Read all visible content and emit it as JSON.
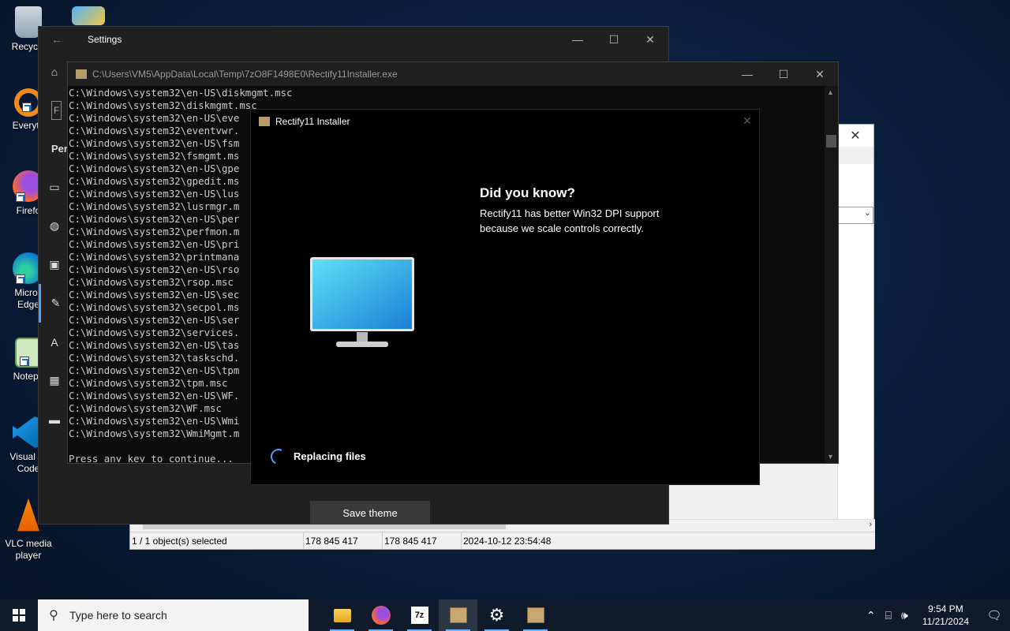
{
  "desktop": {
    "icons": [
      {
        "label": "Recycle",
        "icon": "recycle-bin-icon"
      },
      {
        "label": "Everyth",
        "icon": "everything-search-icon"
      },
      {
        "label": "Firefo",
        "icon": "firefox-icon"
      },
      {
        "label": "Micros\nEdge",
        "icon": "edge-icon"
      },
      {
        "label": "Notepa",
        "icon": "notepad-icon"
      },
      {
        "label": "Visual St\nCode",
        "icon": "vscode-icon"
      },
      {
        "label": "VLC media\nplayer",
        "icon": "vlc-icon"
      }
    ]
  },
  "settings": {
    "title": "Settings",
    "partial_labels": [
      "F",
      "Per"
    ],
    "save_button": "Save theme",
    "nav_icons": [
      "home-icon",
      "picture-icon",
      "palette-icon",
      "lock-screen-icon",
      "themes-icon",
      "font-icon",
      "start-icon",
      "taskbar-icon"
    ]
  },
  "console": {
    "title": "C:\\Users\\VM5\\AppData\\Local\\Temp\\7zO8F1498E0\\Rectify11Installer.exe",
    "lines": [
      "C:\\Windows\\system32\\en-US\\diskmgmt.msc",
      "C:\\Windows\\system32\\diskmgmt.msc",
      "C:\\Windows\\system32\\en-US\\eve",
      "C:\\Windows\\system32\\eventvwr.",
      "C:\\Windows\\system32\\en-US\\fsm",
      "C:\\Windows\\system32\\fsmgmt.ms",
      "C:\\Windows\\system32\\en-US\\gpe",
      "C:\\Windows\\system32\\gpedit.ms",
      "C:\\Windows\\system32\\en-US\\lus",
      "C:\\Windows\\system32\\lusrmgr.m",
      "C:\\Windows\\system32\\en-US\\per",
      "C:\\Windows\\system32\\perfmon.m",
      "C:\\Windows\\system32\\en-US\\pri",
      "C:\\Windows\\system32\\printmana",
      "C:\\Windows\\system32\\en-US\\rso",
      "C:\\Windows\\system32\\rsop.msc",
      "C:\\Windows\\system32\\en-US\\sec",
      "C:\\Windows\\system32\\secpol.ms",
      "C:\\Windows\\system32\\en-US\\ser",
      "C:\\Windows\\system32\\services.",
      "C:\\Windows\\system32\\en-US\\tas",
      "C:\\Windows\\system32\\taskschd.",
      "C:\\Windows\\system32\\en-US\\tpm",
      "C:\\Windows\\system32\\tpm.msc",
      "C:\\Windows\\system32\\en-US\\WF.",
      "C:\\Windows\\system32\\WF.msc",
      "C:\\Windows\\system32\\en-US\\Wmi",
      "C:\\Windows\\system32\\WmiMgmt.m",
      "",
      "Press any key to continue..."
    ]
  },
  "installer": {
    "title": "Rectify11 Installer",
    "heading": "Did you know?",
    "body": "Rectify11 has better Win32 DPI support because we scale controls correctly.",
    "status": "Replacing files"
  },
  "filemanager": {
    "status": [
      "1 / 1 object(s) selected",
      "178 845 417",
      "178 845 417",
      "2024-10-12 23:54:48"
    ]
  },
  "taskbar": {
    "search_placeholder": "Type here to search",
    "apps": [
      "file-explorer-icon",
      "firefox-icon",
      "7zip-icon",
      "installer-icon",
      "settings-gear-icon",
      "installer-icon"
    ],
    "time": "9:54 PM",
    "date": "11/21/2024"
  },
  "colors": {
    "accent": "#4aa3ff",
    "console_bg": "#0c0c0c",
    "settings_bg": "#202020"
  }
}
